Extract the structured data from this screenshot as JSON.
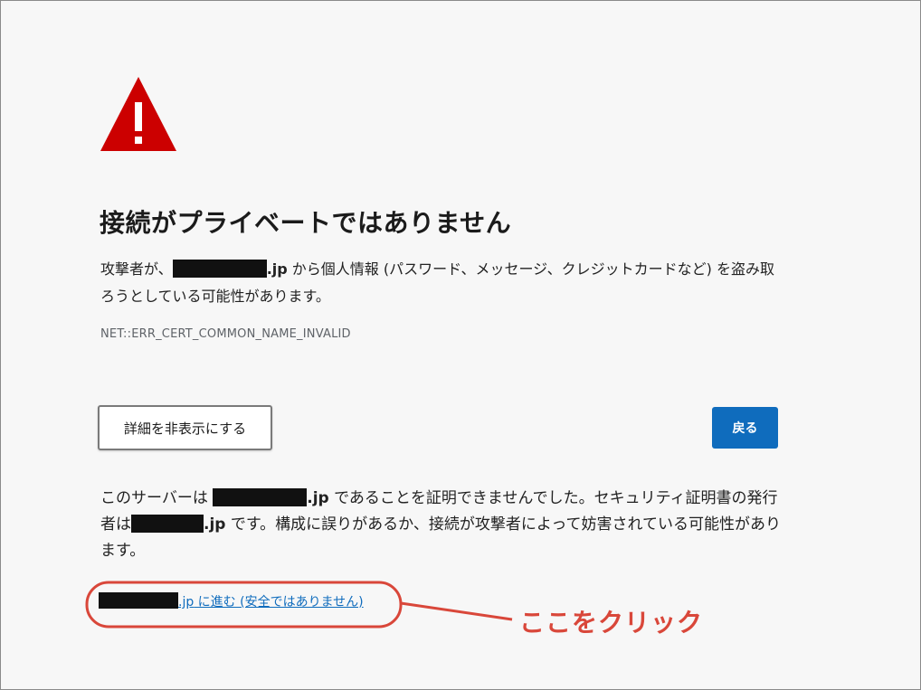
{
  "warning": {
    "icon": "warning-triangle-icon",
    "icon_color": "#cc0000",
    "title": "接続がプライベートではありません"
  },
  "description": {
    "prefix": "攻撃者が、",
    "domain_suffix": ".jp",
    "rest": " から個人情報 (パスワード、メッセージ、クレジットカードなど) を盗み取ろうとしている可能性があります。"
  },
  "error_code": "NET::ERR_CERT_COMMON_NAME_INVALID",
  "buttons": {
    "hide_details": "詳細を非表示にする",
    "back": "戻る"
  },
  "details": {
    "part1": "このサーバーは ",
    "domain1_suffix": ".jp",
    "part2": " であることを証明できませんでした。セキュリティ証明書の発行者は",
    "domain2_suffix": ".jp",
    "part3": " です。構成に誤りがあるか、接続が攻撃者によって妨害されている可能性があります。"
  },
  "proceed_link": {
    "domain_suffix": ".jp",
    "text": " に進む (安全ではありません)"
  },
  "annotation": {
    "label": "ここをクリック",
    "color": "#d9473a"
  },
  "colors": {
    "accent": "#0f6cbd",
    "background": "#f7f7f7"
  }
}
